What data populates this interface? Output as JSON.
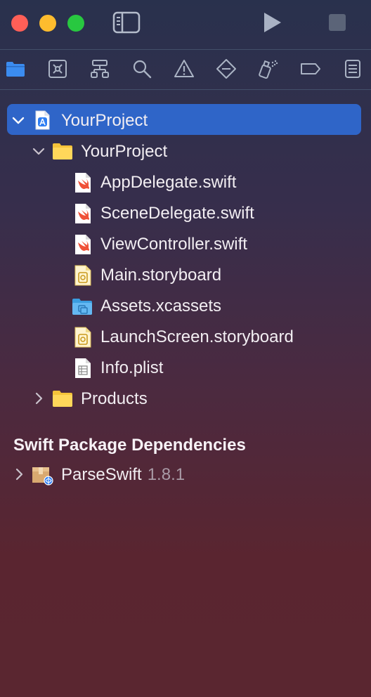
{
  "toolbar": {
    "close": "close",
    "minimize": "minimize",
    "zoom": "zoom",
    "sidebar_icon": "sidebar-toggle-icon",
    "run_icon": "play-icon",
    "stop_icon": "stop-icon"
  },
  "navigator_tabs": [
    {
      "name": "project-navigator",
      "icon": "folder-icon",
      "active": true
    },
    {
      "name": "source-control-navigator",
      "icon": "source-control-icon"
    },
    {
      "name": "symbol-navigator",
      "icon": "hierarchy-icon"
    },
    {
      "name": "find-navigator",
      "icon": "search-icon"
    },
    {
      "name": "issue-navigator",
      "icon": "warning-icon"
    },
    {
      "name": "test-navigator",
      "icon": "diamond-icon"
    },
    {
      "name": "debug-navigator",
      "icon": "spray-icon"
    },
    {
      "name": "breakpoint-navigator",
      "icon": "breakpoint-icon"
    },
    {
      "name": "report-navigator",
      "icon": "report-icon"
    }
  ],
  "tree": {
    "project": "YourProject",
    "group": "YourProject",
    "files": [
      {
        "label": "AppDelegate.swift",
        "type": "swift"
      },
      {
        "label": "SceneDelegate.swift",
        "type": "swift"
      },
      {
        "label": "ViewController.swift",
        "type": "swift"
      },
      {
        "label": "Main.storyboard",
        "type": "storyboard"
      },
      {
        "label": "Assets.xcassets",
        "type": "assets"
      },
      {
        "label": "LaunchScreen.storyboard",
        "type": "storyboard"
      },
      {
        "label": "Info.plist",
        "type": "plist"
      }
    ],
    "products": "Products"
  },
  "packages": {
    "header": "Swift Package Dependencies",
    "items": [
      {
        "name": "ParseSwift",
        "version": "1.8.1"
      }
    ]
  },
  "colors": {
    "selection": "#2f65c8",
    "accent": "#3b8cf0",
    "folder": "#f5c33a"
  }
}
